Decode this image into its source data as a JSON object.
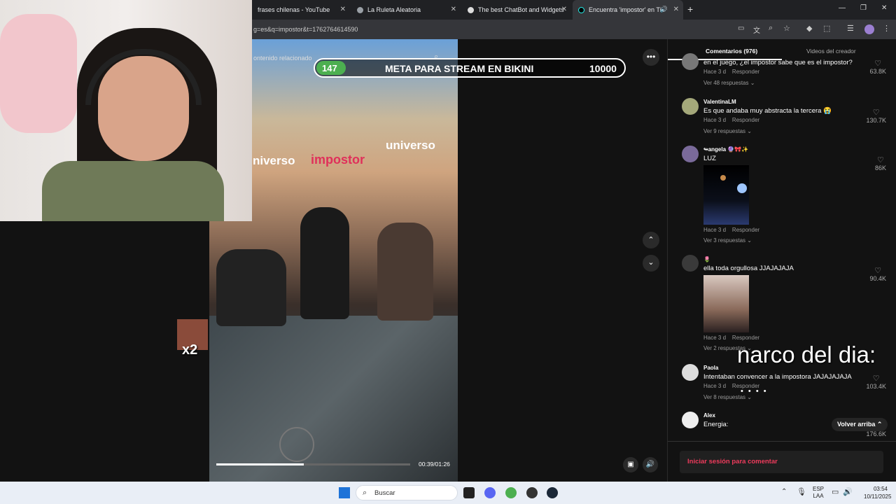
{
  "tabs": [
    {
      "label": "frases chilenas - YouTube"
    },
    {
      "label": "La Ruleta Aleatoria"
    },
    {
      "label": "The best ChatBot and Widgets"
    },
    {
      "label": "Encuentra 'impostor' en Tik"
    }
  ],
  "address": {
    "url": "g=es&q=impostor&t=1762764614590"
  },
  "video": {
    "related": "ontenido relacionado",
    "goal_current": "147",
    "goal_title": "META PARA STREAM EN BIKINI",
    "goal_target": "10000",
    "caption_left": "niverso",
    "caption_mid": "impostor",
    "caption_right": "universo",
    "time": "00:39/01:26",
    "progress": 0.45
  },
  "overlay": {
    "x2": "x2",
    "narco": "narco del dia:"
  },
  "panel": {
    "tab_comments": "Comentarios (976)",
    "tab_videos": "Videos del creador",
    "login": "Iniciar sesión para comentar",
    "back_top": "Volver arriba"
  },
  "comments": [
    {
      "text": "en el juego, ¿el impostor sabe que es el impostor?",
      "time": "Hace 3 d",
      "reply": "Responder",
      "more": "Ver 48 respuestas",
      "likes": "63.8K"
    },
    {
      "user": "ValentinaLM",
      "text": "Es que andaba muy abstracta la tercera 😭",
      "time": "Hace 3 d",
      "reply": "Responder",
      "more": "Ver 9 respuestas",
      "likes": "130.7K"
    },
    {
      "user": "↬angela 🔮🎀✨",
      "text": "LUZ",
      "time": "Hace 3 d",
      "reply": "Responder",
      "more": "Ver 3 respuestas",
      "likes": "86K"
    },
    {
      "user": "🌷",
      "text": "ella toda orgullosa JJAJAJAJA",
      "time": "Hace 3 d",
      "reply": "Responder",
      "more": "Ver 2 respuestas",
      "likes": "90.4K"
    },
    {
      "user": "Paola",
      "text": "Intentaban convencer a la impostora JAJAJAJAJA",
      "time": "Hace 3 d",
      "reply": "Responder",
      "more": "Ver 8 respuestas",
      "likes": "103.4K"
    },
    {
      "user": "Alex",
      "text": "Energia:",
      "likes": "176.6K"
    }
  ],
  "taskbar": {
    "search": "Buscar",
    "lang1": "ESP",
    "lang2": "LAA",
    "time": "03:54",
    "date": "10/11/2025"
  }
}
